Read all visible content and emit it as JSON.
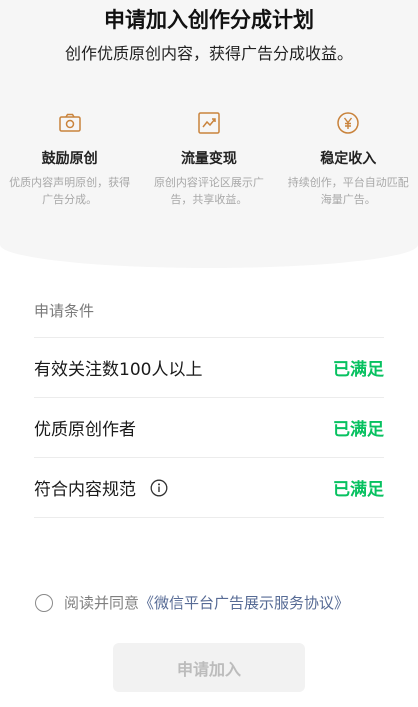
{
  "header": {
    "title": "申请加入创作分成计划",
    "subtitle": "创作优质原创内容，获得广告分成收益。"
  },
  "features": [
    {
      "icon": "camera-icon",
      "title": "鼓励原创",
      "desc": "优质内容声明原创，获得广告分成。"
    },
    {
      "icon": "trend-chart-icon",
      "title": "流量变现",
      "desc": "原创内容评论区展示广告，共享收益。"
    },
    {
      "icon": "yen-coin-icon",
      "title": "稳定收入",
      "desc": "持续创作，平台自动匹配海量广告。"
    }
  ],
  "conditions": {
    "heading": "申请条件",
    "items": [
      {
        "label": "有效关注数100人以上",
        "status": "已满足"
      },
      {
        "label": "优质原创作者",
        "status": "已满足"
      },
      {
        "label": "符合内容规范",
        "status": "已满足",
        "info_icon": "info-icon"
      }
    ]
  },
  "agreement": {
    "prefix": "阅读并同意",
    "link": "《微信平台广告展示服务协议》",
    "checked": false
  },
  "apply_button": {
    "label": "申请加入",
    "enabled": false
  },
  "colors": {
    "accent_green": "#07c160",
    "link_blue": "#576b95",
    "icon_orange": "#c9833c"
  }
}
